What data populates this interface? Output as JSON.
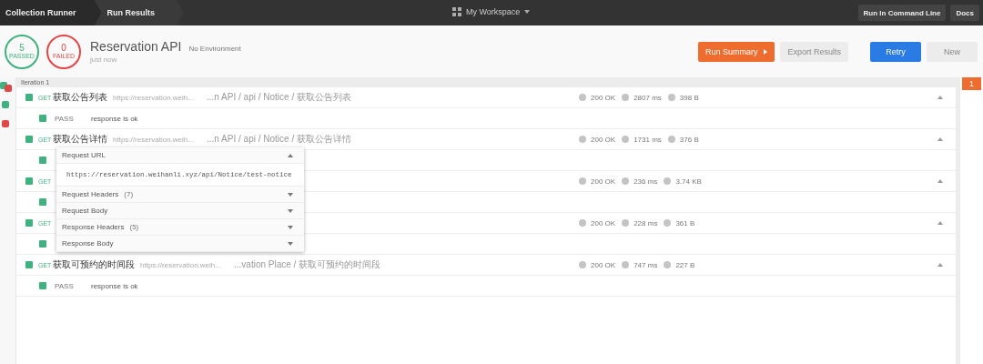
{
  "top_bar": {
    "tabs": [
      {
        "label": "Collection Runner",
        "selected": false
      },
      {
        "label": "Run Results",
        "selected": true
      }
    ],
    "workspace": "My Workspace",
    "buttons": [
      "Run In Command Line",
      "Docs"
    ]
  },
  "summary": {
    "passed": {
      "count": "5",
      "label": "PASSED"
    },
    "failed": {
      "count": "0",
      "label": "FAILED"
    },
    "title": "Reservation API",
    "environment": "No Environment",
    "time": "just now"
  },
  "actions": [
    {
      "label": "Run Summary",
      "kind": "primary"
    },
    {
      "label": "Export Results",
      "kind": "secondary"
    },
    {
      "label": "Retry",
      "kind": "blue"
    },
    {
      "label": "New",
      "kind": "secondary"
    }
  ],
  "gutter": [
    {
      "passed": true
    },
    {
      "passed": false
    },
    {
      "passed": true
    },
    {
      "passed": false
    }
  ],
  "iteration": "Iteration 1",
  "iteration_badge": "1",
  "requests": [
    {
      "method": "GET",
      "name": "获取公告列表",
      "url": "https://reservation.weih...",
      "path": "...n API / api / Notice / 获取公告列表",
      "status": "200 OK",
      "time": "2807 ms",
      "size": "398 B",
      "expanded": true,
      "tests": [
        {
          "result": "PASS",
          "passed": true,
          "message": "response is ok"
        }
      ]
    },
    {
      "method": "GET",
      "name": "获取公告详情",
      "url": "https://reservation.weih...",
      "path": "...n API / api / Notice / 获取公告详情",
      "status": "200 OK",
      "time": "1731 ms",
      "size": "376 B",
      "expanded": true,
      "tests": [
        {
          "passed": true
        }
      ]
    },
    {
      "method": "GET",
      "status": "200 OK",
      "time": "236 ms",
      "size": "3.74 KB",
      "expanded": true,
      "tests": [
        {
          "passed": true
        }
      ]
    },
    {
      "method": "GET",
      "status": "200 OK",
      "time": "228 ms",
      "size": "361 B",
      "expanded": true,
      "tests": [
        {
          "passed": true
        }
      ]
    },
    {
      "method": "GET",
      "name": "获取可预约的时间段",
      "url": "https://reservation.weih...",
      "path": "...vation Place / 获取可预约的时间段",
      "status": "200 OK",
      "time": "747 ms",
      "size": "227 B",
      "expanded": true,
      "tests": [
        {
          "result": "PASS",
          "passed": true,
          "message": "response is ok"
        }
      ]
    }
  ],
  "details_popup": {
    "sections": [
      {
        "label": "Request URL",
        "expanded": true,
        "content": "https://reservation.weihanli.xyz/api/Notice/test-notice"
      },
      {
        "label": "Request Headers",
        "count": "(7)",
        "expanded": false
      },
      {
        "label": "Request Body",
        "expanded": false
      },
      {
        "label": "Response Headers",
        "count": "(5)",
        "expanded": false
      },
      {
        "label": "Response Body",
        "expanded": false
      }
    ]
  }
}
